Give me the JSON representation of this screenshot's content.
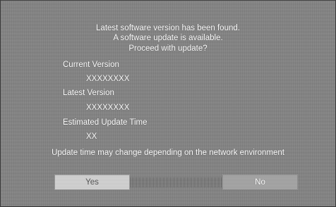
{
  "dialog": {
    "message_lines": [
      "Latest software version has been found.",
      "A software update is available.",
      "Proceed with update?"
    ],
    "current_version_label": "Current Version",
    "current_version_value": "XXXXXXXX",
    "latest_version_label": "Latest Version",
    "latest_version_value": "XXXXXXXX",
    "estimated_time_label": "Estimated Update Time",
    "estimated_time_value": "XX",
    "note": "Update time may change depending on the network environment"
  },
  "buttons": {
    "yes_label": "Yes",
    "no_label": "No",
    "selected": "yes"
  },
  "colors": {
    "background": "#8c8c8c",
    "text": "#ffffff",
    "selected_button": "#d6d6d6",
    "unselected_button": "#a9a9a9"
  }
}
